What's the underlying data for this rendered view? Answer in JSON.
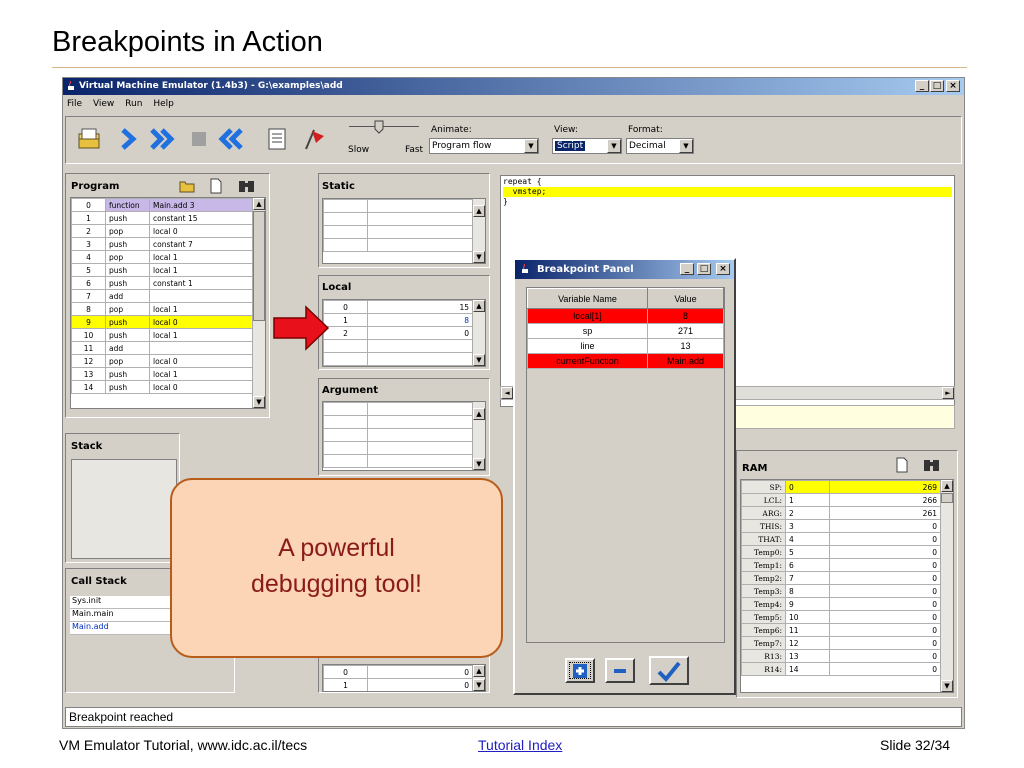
{
  "slide": {
    "title": "Breakpoints in Action",
    "footer_left": "VM Emulator Tutorial, www.idc.ac.il/tecs",
    "footer_link": "Tutorial Index",
    "footer_right": "Slide 32/34",
    "callout_line1": "A powerful",
    "callout_line2": "debugging tool!"
  },
  "window": {
    "title": "Virtual Machine Emulator (1.4b3) - G:\\examples\\add",
    "menu": [
      "File",
      "View",
      "Run",
      "Help"
    ],
    "status": "Breakpoint reached"
  },
  "toolbar": {
    "slow_label": "Slow",
    "fast_label": "Fast",
    "animate_label": "Animate:",
    "animate_value": "Program flow",
    "view_label": "View:",
    "view_value": "Script",
    "format_label": "Format:",
    "format_value": "Decimal"
  },
  "program": {
    "title": "Program",
    "rows": [
      [
        "0",
        "function",
        "Main.add 3"
      ],
      [
        "1",
        "push",
        "constant 15"
      ],
      [
        "2",
        "pop",
        "local 0"
      ],
      [
        "3",
        "push",
        "constant 7"
      ],
      [
        "4",
        "pop",
        "local 1"
      ],
      [
        "5",
        "push",
        "local 1"
      ],
      [
        "6",
        "push",
        "constant 1"
      ],
      [
        "7",
        "add",
        ""
      ],
      [
        "8",
        "pop",
        "local 1"
      ],
      [
        "9",
        "push",
        "local 0"
      ],
      [
        "10",
        "push",
        "local 1"
      ],
      [
        "11",
        "add",
        ""
      ],
      [
        "12",
        "pop",
        "local 0"
      ],
      [
        "13",
        "push",
        "local 1"
      ],
      [
        "14",
        "push",
        "local 0"
      ]
    ]
  },
  "stack": {
    "title": "Stack"
  },
  "call_stack": {
    "title": "Call Stack",
    "items": [
      "Sys.init",
      "Main.main",
      "Main.add"
    ]
  },
  "static": {
    "title": "Static"
  },
  "local": {
    "title": "Local",
    "rows": [
      [
        "0",
        "15"
      ],
      [
        "1",
        "8"
      ],
      [
        "2",
        "0"
      ]
    ]
  },
  "argument": {
    "title": "Argument"
  },
  "temp_rows": [
    [
      "0",
      "0"
    ],
    [
      "1",
      "0"
    ]
  ],
  "script": {
    "lines": [
      "repeat {",
      "  vmstep;",
      "}"
    ]
  },
  "breakpoint_panel": {
    "title": "Breakpoint Panel",
    "col_name": "Variable Name",
    "col_value": "Value",
    "rows": [
      {
        "name": "local[1]",
        "value": "8",
        "hit": true
      },
      {
        "name": "sp",
        "value": "271",
        "hit": false
      },
      {
        "name": "line",
        "value": "13",
        "hit": false
      },
      {
        "name": "currentFunction",
        "value": "Main.add",
        "hit": true
      }
    ]
  },
  "ram": {
    "title": "RAM",
    "rows": [
      [
        "SP:",
        "0",
        "269"
      ],
      [
        "LCL:",
        "1",
        "266"
      ],
      [
        "ARG:",
        "2",
        "261"
      ],
      [
        "THIS:",
        "3",
        "0"
      ],
      [
        "THAT:",
        "4",
        "0"
      ],
      [
        "Temp0:",
        "5",
        "0"
      ],
      [
        "Temp1:",
        "6",
        "0"
      ],
      [
        "Temp2:",
        "7",
        "0"
      ],
      [
        "Temp3:",
        "8",
        "0"
      ],
      [
        "Temp4:",
        "9",
        "0"
      ],
      [
        "Temp5:",
        "10",
        "0"
      ],
      [
        "Temp6:",
        "11",
        "0"
      ],
      [
        "Temp7:",
        "12",
        "0"
      ],
      [
        "R13:",
        "13",
        "0"
      ],
      [
        "R14:",
        "14",
        "0"
      ]
    ]
  },
  "colors": {
    "highlight": "#ffff00",
    "breakpoint_hit": "#ff0000",
    "title_bar": "#0a246a",
    "callout_fill": "#fbd5b5",
    "callout_text": "#8b1a1a"
  }
}
